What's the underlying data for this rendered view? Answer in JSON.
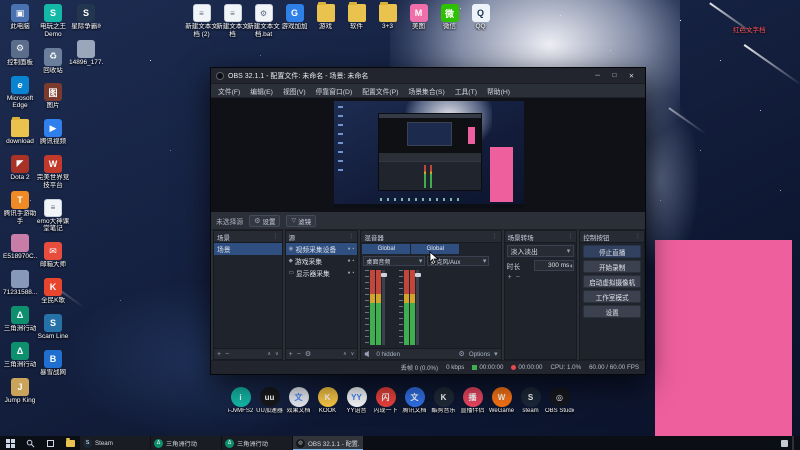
{
  "wallpaper": {
    "pink_block_color": "#ed5f9d",
    "red_file_label": "红色文字档"
  },
  "desktop": {
    "top_row": [
      {
        "label": "新建文本文档 (2)",
        "icon": "textdoc-icon",
        "g": "≡",
        "c": "#f2f5f8"
      },
      {
        "label": "新建文本文档",
        "icon": "textdoc-icon",
        "g": "≡",
        "c": "#f2f5f8"
      },
      {
        "label": "新建文本文档.bat",
        "icon": "bat-file-icon",
        "g": "⚙",
        "c": "#f2f5f8"
      },
      {
        "label": "游戏加加",
        "icon": "gamepp-icon",
        "g": "G",
        "c": "#2f7fe8"
      },
      {
        "label": "游戏",
        "icon": "folder-icon",
        "g": "",
        "c": "#e9c34d"
      },
      {
        "label": "软件",
        "icon": "folder-icon",
        "g": "",
        "c": "#e9c34d"
      },
      {
        "label": "3+3",
        "icon": "folder-icon",
        "g": "",
        "c": "#e9c34d"
      },
      {
        "label": "美图",
        "icon": "meitu-icon",
        "g": "M",
        "c": "#f06eaa"
      },
      {
        "label": "微信",
        "icon": "wechat-icon",
        "g": "微",
        "c": "#2dc100"
      },
      {
        "label": "QQ",
        "icon": "qq-icon",
        "g": "Q",
        "c": "#eef3f9"
      }
    ],
    "col1": [
      {
        "label": "此电脑",
        "icon": "this-pc-icon",
        "g": "▣",
        "c": "#4a72b0"
      },
      {
        "label": "控制面板",
        "icon": "control-panel-icon",
        "g": "⚙",
        "c": "#5a6e8c"
      },
      {
        "label": "Microsoft Edge",
        "icon": "edge-icon",
        "g": "e",
        "c": "#0a84d0"
      },
      {
        "label": "download",
        "icon": "folder-icon",
        "g": "",
        "c": "#e9c34d"
      },
      {
        "label": "Dota 2",
        "icon": "dota2-icon",
        "g": "◤",
        "c": "#a93226"
      },
      {
        "label": "腾讯手游助手",
        "icon": "tencent-gamehelper-icon",
        "g": "T",
        "c": "#f08a24"
      },
      {
        "label": "E518970C...",
        "icon": "image-file-icon",
        "g": "",
        "c": "#c87ca8"
      },
      {
        "label": "71231588...",
        "icon": "image-file-icon",
        "g": "",
        "c": "#8898b8"
      },
      {
        "label": "三角洲行动",
        "icon": "delta-force-icon",
        "g": "Δ",
        "c": "#0e8f6e"
      },
      {
        "label": "三角洲行动",
        "icon": "delta-force-icon",
        "g": "Δ",
        "c": "#0e8f6e"
      },
      {
        "label": "Jump King",
        "icon": "jump-king-icon",
        "g": "J",
        "c": "#caa45a"
      }
    ],
    "col2": [
      {
        "label": "电玩之王 Demo",
        "icon": "s-game-icon",
        "g": "S",
        "c": "#14b8a6"
      },
      {
        "label": "回收站",
        "icon": "recycle-bin-icon",
        "g": "♻",
        "c": "#6b7f9c"
      },
      {
        "label": "图片",
        "icon": "pictures-icon",
        "g": "图",
        "c": "#7a3b2e"
      },
      {
        "label": "腾讯视频",
        "icon": "tencent-video-icon",
        "g": "▶",
        "c": "#2f80ed"
      },
      {
        "label": "完美世界竞技平台",
        "icon": "perfect-world-icon",
        "g": "W",
        "c": "#c0392b"
      },
      {
        "label": "emo大神课堂笔记",
        "icon": "textdoc-icon",
        "g": "≡",
        "c": "#f2f5f8"
      },
      {
        "label": "邮箱大师",
        "icon": "mail-master-icon",
        "g": "✉",
        "c": "#e74c3c"
      },
      {
        "label": "全民K歌",
        "icon": "ksong-icon",
        "g": "K",
        "c": "#e8452e"
      },
      {
        "label": "Scam Line",
        "icon": "steam-link-icon",
        "g": "S",
        "c": "#2571a8"
      },
      {
        "label": "暴雪战网",
        "icon": "battlenet-icon",
        "g": "B",
        "c": "#1f6fd0"
      }
    ],
    "col3": [
      {
        "label": "星际争霸II",
        "icon": "starcraft-icon",
        "g": "S",
        "c": "#23364f"
      },
      {
        "label": "14896_177...",
        "icon": "image-file-icon",
        "g": "",
        "c": "#9aa7bb"
      }
    ],
    "dock": [
      {
        "label": "i-JvMFS2",
        "icon": "vm-icon",
        "g": "i",
        "c": "#14b8a6"
      },
      {
        "label": "UU加速器",
        "icon": "uu-booster-icon",
        "g": "uu",
        "c": "#17181c"
      },
      {
        "label": "效果文档",
        "icon": "doc-icon",
        "g": "文",
        "c": "#e5e9f0"
      },
      {
        "label": "KOOK",
        "icon": "kook-icon",
        "g": "K",
        "c": "#f6c445"
      },
      {
        "label": "YY语音",
        "icon": "yy-icon",
        "g": "YY",
        "c": "#f5f7fa"
      },
      {
        "label": "闪现一下",
        "icon": "shanxian-icon",
        "g": "闪",
        "c": "#e7413c"
      },
      {
        "label": "腾讯文档",
        "icon": "tencent-docs-icon",
        "g": "文",
        "c": "#2f6fe4"
      },
      {
        "label": "酷狗音乐",
        "icon": "kugou-icon",
        "g": "K",
        "c": "#1f2937"
      },
      {
        "label": "直播伴侣",
        "icon": "live-companion-icon",
        "g": "播",
        "c": "#e94560"
      },
      {
        "label": "WeGame",
        "icon": "wegame-icon",
        "g": "W",
        "c": "#f97316"
      },
      {
        "label": "steam",
        "icon": "steam-icon",
        "g": "S",
        "c": "#1b2838"
      },
      {
        "label": "OBS Studio",
        "icon": "obs-icon",
        "g": "◎",
        "c": "#15171c"
      }
    ]
  },
  "obs": {
    "title": "OBS 32.1.1 - 配置文件: 未命名 - 场景: 未命名",
    "window_controls": {
      "min": "─",
      "max": "□",
      "close": "✕"
    },
    "menu": [
      {
        "label": "文件(F)"
      },
      {
        "label": "编辑(E)"
      },
      {
        "label": "视图(V)"
      },
      {
        "label": "停靠窗口(D)"
      },
      {
        "label": "配置文件(P)"
      },
      {
        "label": "场景集合(S)"
      },
      {
        "label": "工具(T)"
      },
      {
        "label": "帮助(H)"
      }
    ],
    "source_bar": {
      "message": "未选择源",
      "settings": "设置",
      "filters": "滤镜"
    },
    "scenes": {
      "title": "场景",
      "items": [
        {
          "label": "场景",
          "cls": "sel"
        }
      ]
    },
    "sources": {
      "title": "源",
      "items": [
        {
          "label": "视频采集设备",
          "icon": "camera-icon",
          "g": "◉",
          "cls": "sel"
        },
        {
          "label": "游戏采集",
          "icon": "game-capture-icon",
          "g": "◆",
          "cls": ""
        },
        {
          "label": "显示器采集",
          "icon": "display-capture-icon",
          "g": "▭",
          "cls": ""
        }
      ]
    },
    "mixer": {
      "title": "混音器",
      "tabs": [
        {
          "label": "Global"
        },
        {
          "label": "Global"
        }
      ],
      "channels": [
        {
          "label": "桌面音频"
        },
        {
          "label": "麦克风/Aux"
        }
      ],
      "hidden": "0 hidden",
      "options": "Options"
    },
    "transitions": {
      "title": "场景转场",
      "selected": "淡入淡出",
      "duration_label": "时长",
      "duration": "300 ms"
    },
    "controls": {
      "title": "控制按钮",
      "buttons": [
        {
          "label": "停止直播",
          "name": "stop-streaming-button",
          "cls": "primary"
        },
        {
          "label": "开始录制",
          "name": "start-recording-button",
          "cls": ""
        },
        {
          "label": "启动虚拟摄像机",
          "name": "start-virtualcam-button",
          "cls": ""
        },
        {
          "label": "工作室模式",
          "name": "studio-mode-button",
          "cls": ""
        },
        {
          "label": "设置",
          "name": "obs-settings-button",
          "cls": ""
        }
      ]
    },
    "status": {
      "dropped": "丢帧 0 (0.0%)",
      "bitrate": "0 kbps",
      "stream_time": "00:00:00",
      "record_time": "00:00:00",
      "cpu": "CPU: 1.0%",
      "fps": "60.00 / 60.00 FPS"
    }
  },
  "taskbar": {
    "buttons": [
      {
        "label": "Steam",
        "icon": "steam-icon",
        "g": "S",
        "c": "#1b2838",
        "cls": ""
      },
      {
        "label": "三角洲行动",
        "icon": "delta-force-icon",
        "g": "Δ",
        "c": "#0e8f6e",
        "cls": ""
      },
      {
        "label": "三角洲行动",
        "icon": "delta-force-icon",
        "g": "Δ",
        "c": "#0e8f6e",
        "cls": ""
      },
      {
        "label": "OBS 32.1.1 - 配置...",
        "icon": "obs-icon",
        "g": "◎",
        "c": "#15171c",
        "cls": "active"
      }
    ]
  }
}
